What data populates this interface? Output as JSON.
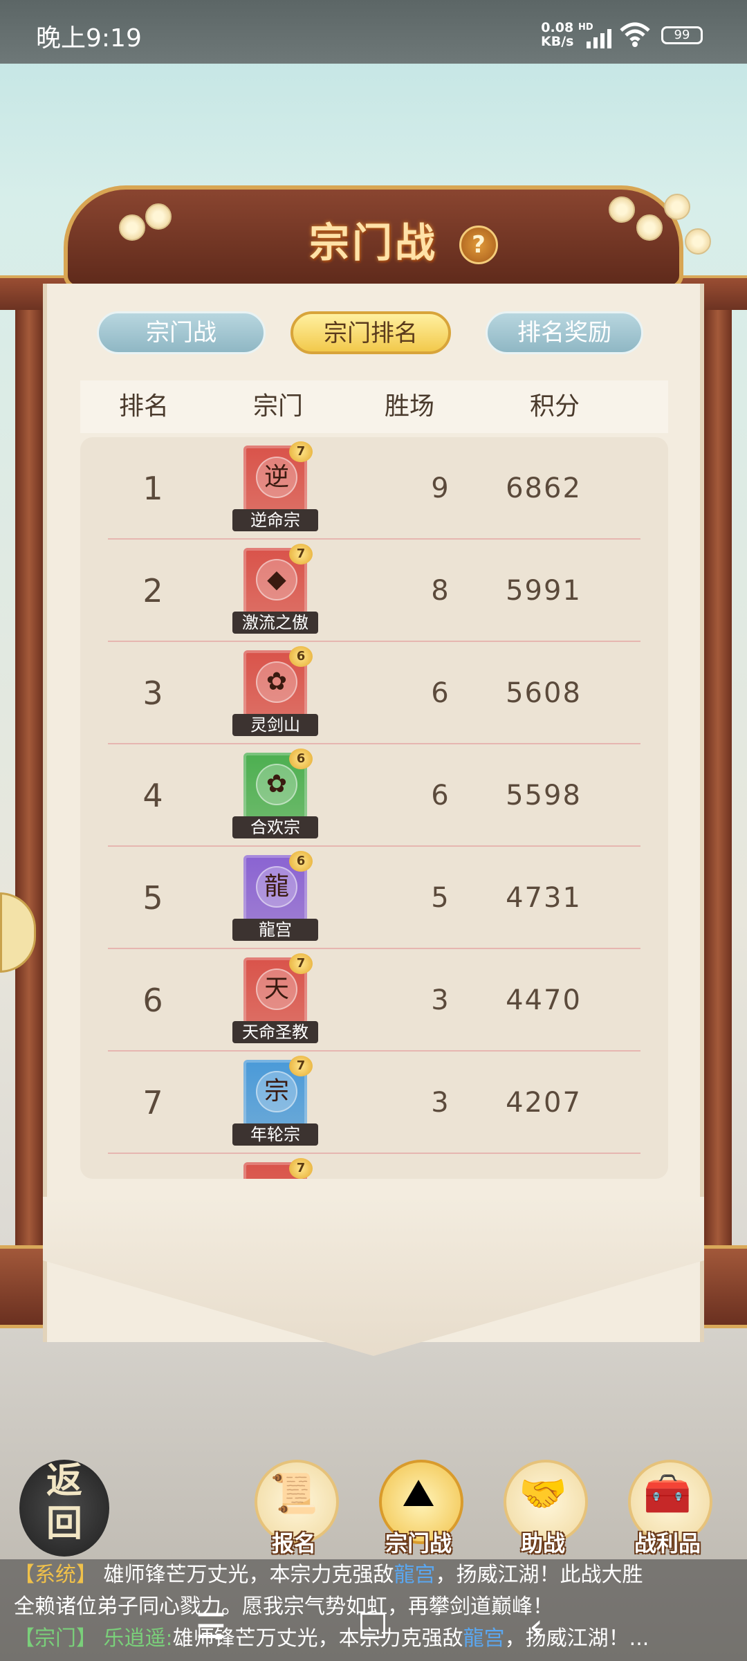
{
  "status_bar": {
    "time": "晚上9:19",
    "network_speed": "0.08\nKB/s",
    "hd": "HD",
    "battery": "99"
  },
  "header": {
    "title": "宗门战",
    "help_label": "?"
  },
  "tabs": [
    {
      "label": "宗门战",
      "active": false
    },
    {
      "label": "宗门排名",
      "active": true
    },
    {
      "label": "排名奖励",
      "active": false
    }
  ],
  "table": {
    "columns": [
      "排名",
      "宗门",
      "胜场",
      "积分"
    ],
    "rows": [
      {
        "rank": "1",
        "sect": "逆命宗",
        "emblem": "逆",
        "level": "7",
        "wins": "9",
        "score": "6862",
        "color": "#d9534a"
      },
      {
        "rank": "2",
        "sect": "激流之傲",
        "emblem": "◆",
        "level": "7",
        "wins": "8",
        "score": "5991",
        "color": "#d9534a"
      },
      {
        "rank": "3",
        "sect": "灵剑山",
        "emblem": "✿",
        "level": "6",
        "wins": "6",
        "score": "5608",
        "color": "#d9534a"
      },
      {
        "rank": "4",
        "sect": "合欢宗",
        "emblem": "✿",
        "level": "6",
        "wins": "6",
        "score": "5598",
        "color": "#4caf50"
      },
      {
        "rank": "5",
        "sect": "龍宫",
        "emblem": "龍",
        "level": "6",
        "wins": "5",
        "score": "4731",
        "color": "#8a63d2"
      },
      {
        "rank": "6",
        "sect": "天命圣教",
        "emblem": "天",
        "level": "7",
        "wins": "3",
        "score": "4470",
        "color": "#d9534a"
      },
      {
        "rank": "7",
        "sect": "年轮宗",
        "emblem": "宗",
        "level": "7",
        "wins": "3",
        "score": "4207",
        "color": "#4a9ad8"
      },
      {
        "rank": "",
        "sect": "",
        "emblem": "",
        "level": "7",
        "wins": "",
        "score": "",
        "color": "#d9534a"
      }
    ]
  },
  "bottom_nav": {
    "back_label": "返\n回",
    "items": [
      {
        "label": "报名",
        "icon": "scroll-brush-icon"
      },
      {
        "label": "宗门战",
        "icon": "flag-mountain-icon"
      },
      {
        "label": "助战",
        "icon": "handshake-icon"
      },
      {
        "label": "战利品",
        "icon": "treasure-chest-icon"
      }
    ]
  },
  "chat": {
    "line1_tag": "【系统】",
    "line1_a": "雄师锋芒万丈光，本宗力克强敌",
    "line1_hl": "龍宫",
    "line1_b": "，扬威江湖！此战大胜",
    "line2": "全赖诸位弟子同心戮力。愿我宗气势如虹，再攀剑道巅峰！",
    "line3_tag": "【宗门】",
    "line3_user": "乐逍遥:",
    "line3_a": "雄师锋芒万丈光，本宗力克强敌",
    "line3_hl": "龍宫",
    "line3_b": "，扬威江湖！..."
  },
  "system_nav": {
    "menu": "☰",
    "home": "☐",
    "back": "‹"
  }
}
